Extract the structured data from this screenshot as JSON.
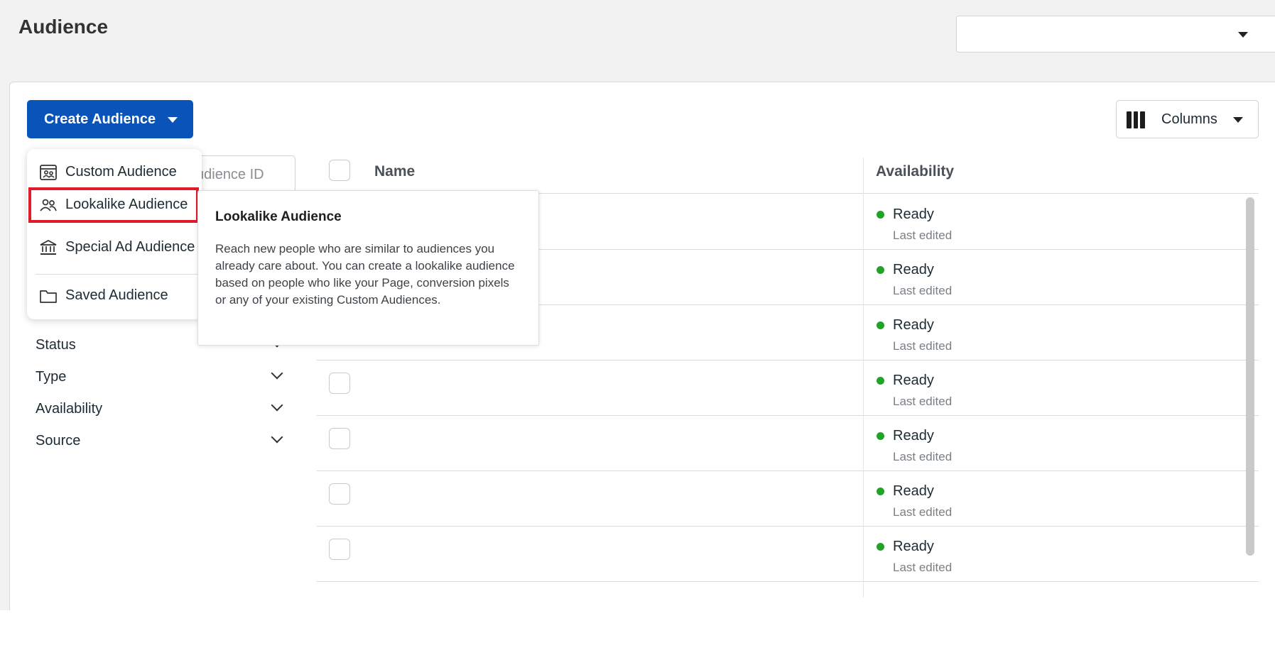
{
  "page": {
    "title": "Audience"
  },
  "top_select": {
    "value": ""
  },
  "toolbar": {
    "create_label": "Create Audience",
    "columns_label": "Columns"
  },
  "search": {
    "placeholder_visible": "udience ID"
  },
  "create_menu": {
    "items": [
      {
        "label": "Custom Audience",
        "icon": "custom-audience-icon"
      },
      {
        "label": "Lookalike Audience",
        "icon": "people-icon",
        "selected": true
      },
      {
        "label": "Special Ad Audience",
        "icon": "bank-building-icon"
      },
      {
        "label": "Saved Audience",
        "icon": "folder-icon"
      }
    ]
  },
  "tooltip": {
    "title": "Lookalike Audience",
    "body": "Reach new people who are similar to audiences you already care about. You can create a lookalike audience based on people who like your Page, conversion pixels or any of your existing Custom Audiences."
  },
  "filters": [
    {
      "label": "Status"
    },
    {
      "label": "Type"
    },
    {
      "label": "Availability"
    },
    {
      "label": "Source"
    }
  ],
  "table": {
    "columns": {
      "name": "Name",
      "availability": "Availability"
    },
    "rows": [
      {
        "status": "Ready",
        "edited": "Last edited"
      },
      {
        "status": "Ready",
        "edited": "Last edited"
      },
      {
        "status": "Ready",
        "edited": "Last edited"
      },
      {
        "status": "Ready",
        "edited": "Last edited"
      },
      {
        "status": "Ready",
        "edited": "Last edited"
      },
      {
        "status": "Ready",
        "edited": "Last edited"
      },
      {
        "status": "Ready",
        "edited": "Last edited"
      }
    ]
  },
  "colors": {
    "primary": "#0a53b8",
    "ready_dot": "#22a12b",
    "highlight": "#e01b2b"
  }
}
